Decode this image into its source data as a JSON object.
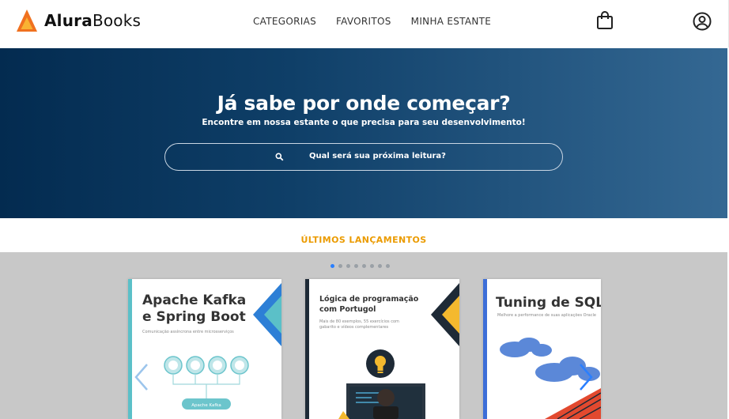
{
  "app": {
    "logo_bold": "Alura",
    "logo_rest": "Books"
  },
  "nav": {
    "items": [
      {
        "label": "CATEGORIAS"
      },
      {
        "label": "FAVORITOS"
      },
      {
        "label": "MINHA ESTANTE"
      }
    ]
  },
  "hero": {
    "title": "Já sabe por onde começar?",
    "subtitle": "Encontre em nossa estante o que precisa para seu desenvolvimento!",
    "search_placeholder": "Qual será sua próxima leitura?"
  },
  "section": {
    "title": "ÚLTIMOS LANÇAMENTOS"
  },
  "carousel": {
    "dot_count": 8,
    "active_dot": 0,
    "books": [
      {
        "title_line1": "Apache Kafka",
        "title_line2": "e Spring Boot",
        "subtitle": "Comunicação assíncrona entre microsserviços",
        "button": "Apache Kafka"
      },
      {
        "title_line1": "Lógica de programação",
        "title_line2": "com Portugol",
        "subtitle_line1": "Mais de 80 exemplos, 55 exercícios com",
        "subtitle_line2": "gabarito e vídeos complementares"
      },
      {
        "title_line1": "Tuning de SQL",
        "subtitle": "Melhore a performance de suas aplicações Oracle"
      }
    ]
  },
  "colors": {
    "accent": "#eb9b00",
    "hero_start": "#032b50",
    "hero_end": "#346893",
    "active_dot": "#2a7fff"
  }
}
